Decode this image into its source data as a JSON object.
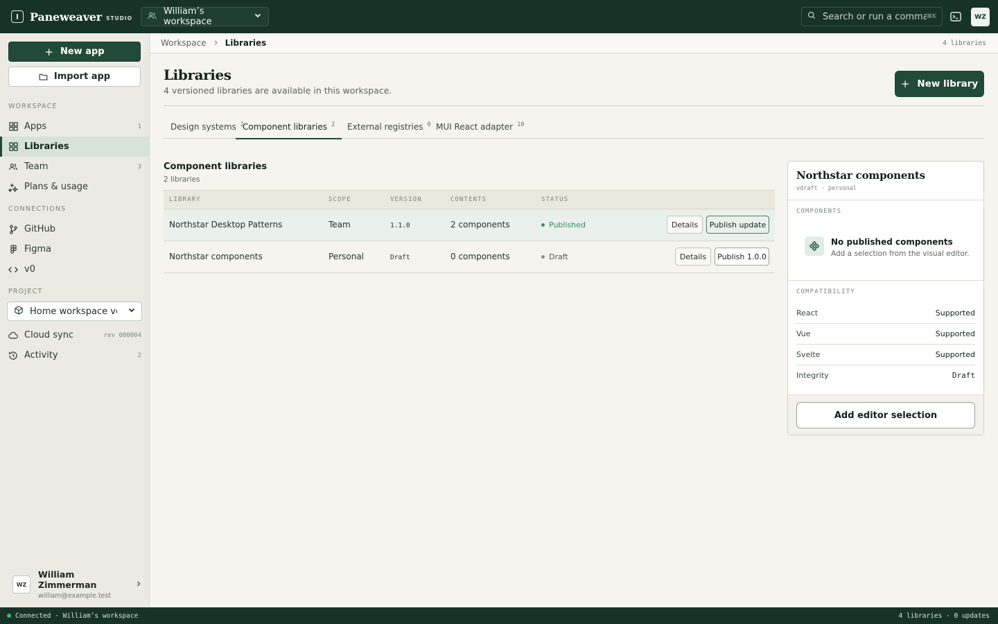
{
  "app": {
    "name": "Paneweaver",
    "edition": "STUDIO",
    "workspace": "William’s workspace",
    "search_placeholder": "Search or run a command",
    "search_shortcut": "⌘K",
    "avatar_initials": "WZ"
  },
  "sidebar": {
    "new_app_label": "New app",
    "import_app_label": "Import app",
    "workspace_section": "WORKSPACE",
    "workspace_items": [
      {
        "label": "Apps",
        "count": "1",
        "icon": "grid-icon"
      },
      {
        "label": "Libraries",
        "count": "",
        "icon": "libraries-grid-icon",
        "active": true
      },
      {
        "label": "Team",
        "count": "3",
        "icon": "users-icon"
      },
      {
        "label": "Plans & usage",
        "count": "",
        "icon": "sparkle-icon"
      }
    ],
    "connections_section": "CONNECTIONS",
    "connection_items": [
      {
        "label": "GitHub",
        "icon": "git-branch-icon"
      },
      {
        "label": "Figma",
        "icon": "figma-icon"
      },
      {
        "label": "v0",
        "icon": "code-icon"
      }
    ],
    "project_section": "PROJECT",
    "project_value": "Home workspace version",
    "project_items": [
      {
        "label": "Cloud sync",
        "count": "rev 000004",
        "icon": "cloud-icon"
      },
      {
        "label": "Activity",
        "count": "2",
        "icon": "history-icon"
      }
    ],
    "user": {
      "initials": "WZ",
      "name": "William Zimmerman",
      "email": "william@example.test"
    }
  },
  "breadcrumb": {
    "root": "Workspace",
    "current": "Libraries",
    "count": "4 libraries"
  },
  "header": {
    "title": "Libraries",
    "subtitle": "4 versioned libraries are available in this workspace.",
    "new_library_label": "New library"
  },
  "tabs": [
    {
      "label": "Design systems",
      "count": "2"
    },
    {
      "label": "Component libraries",
      "count": "2",
      "active": true
    },
    {
      "label": "External registries",
      "count": "0"
    },
    {
      "label": "MUI React adapter",
      "count": "10"
    }
  ],
  "section": {
    "title": "Component libraries",
    "subtitle": "2 libraries"
  },
  "table": {
    "columns": [
      "LIBRARY",
      "SCOPE",
      "VERSION",
      "CONTENTS",
      "STATUS"
    ],
    "rows": [
      {
        "library": "Northstar Desktop Patterns",
        "scope": "Team",
        "version": "1.1.0",
        "contents": "2 components",
        "status": "Published",
        "details_label": "Details",
        "action_label": "Publish update"
      },
      {
        "library": "Northstar components",
        "scope": "Personal",
        "version": "Draft",
        "contents": "0 components",
        "status": "Draft",
        "details_label": "Details",
        "action_label": "Publish 1.0.0"
      }
    ]
  },
  "panel": {
    "title": "Northstar components",
    "meta": "vdraft · personal",
    "components_label": "COMPONENTS",
    "empty_title": "No published components",
    "empty_sub": "Add a selection from the visual editor.",
    "compat_label": "COMPATIBILITY",
    "compat": [
      {
        "name": "React",
        "value": "Supported"
      },
      {
        "name": "Vue",
        "value": "Supported"
      },
      {
        "name": "Svelte",
        "value": "Supported"
      },
      {
        "name": "Integrity",
        "value": "Draft"
      }
    ],
    "add_selection_label": "Add editor selection"
  },
  "statusbar": {
    "left": "Connected · William’s workspace",
    "right": "4 libraries · 0 updates"
  },
  "colors": {
    "brand_dark": "#173227",
    "accent": "#224a38",
    "published": "#3d8a5f",
    "draft": "#8a8f88"
  }
}
